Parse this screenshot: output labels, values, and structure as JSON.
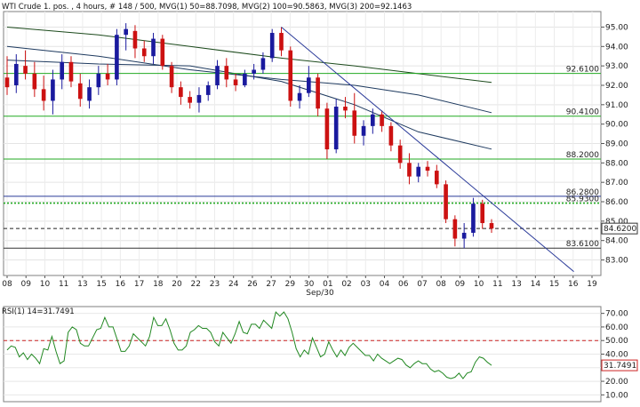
{
  "header": {
    "main_info": "WTI Crude 1. pos. , 4 hours, # 148 / 500, MVG(1) 50=88.7098, MVG(2) 100=90.5863, MVG(3) 200=92.1463",
    "rsi_info": "RSI(1) 14=31.7491"
  },
  "colors": {
    "up_candle": "#1a1a9e",
    "down_candle": "#cc1111",
    "mvg_dark": "#1e3a5f",
    "mvg_200": "#1c4a1c",
    "support_level": "#22aa22",
    "trendline": "#2a3a99",
    "rsi_line": "#228822",
    "rsi_ref": "#cc2222"
  },
  "chart_data": [
    {
      "type": "candlestick",
      "instrument": "WTI Crude 1. pos.",
      "timeframe": "4 hours",
      "ylim": [
        82.2,
        95.8
      ],
      "y_ticks": [
        83.0,
        84.0,
        85.0,
        86.0,
        87.0,
        88.0,
        89.0,
        90.0,
        91.0,
        92.0,
        93.0,
        94.0,
        95.0
      ],
      "x_tick_labels": [
        "08",
        "09",
        "10",
        "11",
        "13",
        "15",
        "16",
        "17",
        "18",
        "20",
        "22",
        "23",
        "24",
        "26",
        "27",
        "29",
        "30",
        "01",
        "02",
        "03",
        "04",
        "06",
        "07",
        "08",
        "09",
        "10",
        "11",
        "13",
        "14",
        "15",
        "16",
        "19"
      ],
      "x_axis_annotation": "Sep/30",
      "horizontal_levels": [
        {
          "label": "92.6100",
          "value": 92.61,
          "style": "green"
        },
        {
          "label": "90.4100",
          "value": 90.41,
          "style": "green"
        },
        {
          "label": "88.2000",
          "value": 88.2,
          "style": "green"
        },
        {
          "label": "86.2800",
          "value": 86.28,
          "style": "blue"
        },
        {
          "label": "85.9300",
          "value": 85.93,
          "style": "green-dotted"
        },
        {
          "label": "83.6100",
          "value": 83.61,
          "style": "dark"
        }
      ],
      "current_price": {
        "label": "84.6200",
        "value": 84.62
      },
      "candles": [
        {
          "o": 92.4,
          "h": 93.5,
          "l": 91.5,
          "c": 91.9
        },
        {
          "o": 92.0,
          "h": 93.6,
          "l": 91.6,
          "c": 93.1
        },
        {
          "o": 93.0,
          "h": 93.8,
          "l": 92.3,
          "c": 92.6
        },
        {
          "o": 92.6,
          "h": 93.2,
          "l": 91.4,
          "c": 91.8
        },
        {
          "o": 91.8,
          "h": 92.5,
          "l": 90.7,
          "c": 91.2
        },
        {
          "o": 91.2,
          "h": 92.8,
          "l": 90.5,
          "c": 92.3
        },
        {
          "o": 92.3,
          "h": 93.6,
          "l": 91.8,
          "c": 93.2
        },
        {
          "o": 93.2,
          "h": 93.5,
          "l": 91.9,
          "c": 92.2
        },
        {
          "o": 92.1,
          "h": 92.6,
          "l": 90.9,
          "c": 91.3
        },
        {
          "o": 91.2,
          "h": 92.3,
          "l": 90.8,
          "c": 91.9
        },
        {
          "o": 91.9,
          "h": 93.0,
          "l": 91.5,
          "c": 92.6
        },
        {
          "o": 92.6,
          "h": 93.1,
          "l": 92.0,
          "c": 92.3
        },
        {
          "o": 92.3,
          "h": 94.9,
          "l": 92.0,
          "c": 94.6
        },
        {
          "o": 94.6,
          "h": 95.2,
          "l": 93.8,
          "c": 94.9
        },
        {
          "o": 94.8,
          "h": 95.1,
          "l": 93.4,
          "c": 93.9
        },
        {
          "o": 93.9,
          "h": 94.3,
          "l": 93.2,
          "c": 93.5
        },
        {
          "o": 93.5,
          "h": 94.7,
          "l": 93.1,
          "c": 94.4
        },
        {
          "o": 94.4,
          "h": 94.6,
          "l": 92.8,
          "c": 93.0
        },
        {
          "o": 93.0,
          "h": 93.2,
          "l": 91.6,
          "c": 91.9
        },
        {
          "o": 91.9,
          "h": 92.2,
          "l": 91.0,
          "c": 91.4
        },
        {
          "o": 91.4,
          "h": 91.7,
          "l": 90.8,
          "c": 91.1
        },
        {
          "o": 91.1,
          "h": 91.9,
          "l": 90.6,
          "c": 91.5
        },
        {
          "o": 91.5,
          "h": 92.2,
          "l": 91.2,
          "c": 92.0
        },
        {
          "o": 92.0,
          "h": 93.3,
          "l": 91.8,
          "c": 93.0
        },
        {
          "o": 93.0,
          "h": 93.4,
          "l": 91.9,
          "c": 92.3
        },
        {
          "o": 92.3,
          "h": 92.6,
          "l": 91.7,
          "c": 92.0
        },
        {
          "o": 92.0,
          "h": 92.8,
          "l": 91.9,
          "c": 92.6
        },
        {
          "o": 92.6,
          "h": 93.1,
          "l": 92.3,
          "c": 92.8
        },
        {
          "o": 92.8,
          "h": 93.7,
          "l": 92.6,
          "c": 93.4
        },
        {
          "o": 93.4,
          "h": 94.9,
          "l": 93.2,
          "c": 94.7
        },
        {
          "o": 94.7,
          "h": 95.0,
          "l": 93.5,
          "c": 93.8
        },
        {
          "o": 93.8,
          "h": 94.0,
          "l": 90.9,
          "c": 91.2
        },
        {
          "o": 91.2,
          "h": 92.0,
          "l": 90.8,
          "c": 91.6
        },
        {
          "o": 91.6,
          "h": 93.0,
          "l": 91.4,
          "c": 92.4
        },
        {
          "o": 92.4,
          "h": 92.6,
          "l": 90.4,
          "c": 90.8
        },
        {
          "o": 90.8,
          "h": 91.1,
          "l": 88.2,
          "c": 88.7
        },
        {
          "o": 88.7,
          "h": 91.3,
          "l": 88.5,
          "c": 90.9
        },
        {
          "o": 90.9,
          "h": 91.4,
          "l": 90.3,
          "c": 90.7
        },
        {
          "o": 90.7,
          "h": 91.6,
          "l": 89.0,
          "c": 89.4
        },
        {
          "o": 89.4,
          "h": 90.2,
          "l": 88.9,
          "c": 89.9
        },
        {
          "o": 89.9,
          "h": 90.8,
          "l": 89.5,
          "c": 90.5
        },
        {
          "o": 90.5,
          "h": 90.7,
          "l": 89.6,
          "c": 89.9
        },
        {
          "o": 89.9,
          "h": 90.1,
          "l": 88.6,
          "c": 88.9
        },
        {
          "o": 88.9,
          "h": 89.2,
          "l": 87.7,
          "c": 88.0
        },
        {
          "o": 88.0,
          "h": 88.5,
          "l": 86.9,
          "c": 87.3
        },
        {
          "o": 87.3,
          "h": 88.0,
          "l": 87.0,
          "c": 87.8
        },
        {
          "o": 87.8,
          "h": 88.1,
          "l": 87.3,
          "c": 87.6
        },
        {
          "o": 87.6,
          "h": 87.9,
          "l": 86.7,
          "c": 86.9
        },
        {
          "o": 86.9,
          "h": 87.1,
          "l": 84.9,
          "c": 85.1
        },
        {
          "o": 85.1,
          "h": 85.3,
          "l": 83.7,
          "c": 84.1
        },
        {
          "o": 84.1,
          "h": 84.9,
          "l": 83.6,
          "c": 84.4
        },
        {
          "o": 84.4,
          "h": 86.2,
          "l": 84.2,
          "c": 85.9
        },
        {
          "o": 85.9,
          "h": 86.1,
          "l": 84.6,
          "c": 84.9
        },
        {
          "o": 84.9,
          "h": 85.1,
          "l": 84.4,
          "c": 84.62
        }
      ],
      "moving_averages": [
        {
          "name": "MVG(1) 50",
          "last": 88.7098,
          "points": [
            [
              0,
              93.3
            ],
            [
              10,
              93.1
            ],
            [
              20,
              93.0
            ],
            [
              30,
              92.2
            ],
            [
              38,
              91.0
            ],
            [
              45,
              89.6
            ],
            [
              53,
              88.71
            ]
          ]
        },
        {
          "name": "MVG(2) 100",
          "last": 90.5863,
          "points": [
            [
              0,
              94.0
            ],
            [
              10,
              93.5
            ],
            [
              20,
              92.8
            ],
            [
              30,
              92.3
            ],
            [
              38,
              92.0
            ],
            [
              45,
              91.5
            ],
            [
              53,
              90.59
            ]
          ]
        },
        {
          "name": "MVG(3) 200",
          "last": 92.1463,
          "points": [
            [
              0,
              95.0
            ],
            [
              10,
              94.6
            ],
            [
              20,
              94.0
            ],
            [
              30,
              93.4
            ],
            [
              38,
              93.0
            ],
            [
              45,
              92.6
            ],
            [
              53,
              92.15
            ]
          ]
        }
      ],
      "trendline": {
        "points": [
          [
            30,
            95.0
          ],
          [
            62,
            82.4
          ]
        ]
      }
    },
    {
      "type": "line",
      "name": "RSI(1) 14",
      "last": 31.7491,
      "ylim": [
        5,
        75
      ],
      "y_ticks": [
        10,
        20,
        30,
        40,
        50,
        60,
        70
      ],
      "reference_level": 50,
      "values": [
        43,
        46,
        45,
        38,
        41,
        36,
        40,
        37,
        33,
        44,
        43,
        53,
        42,
        33,
        35,
        56,
        60,
        58,
        48,
        46,
        46,
        52,
        58,
        59,
        67,
        60,
        60,
        51,
        42,
        42,
        46,
        55,
        52,
        49,
        46,
        53,
        67,
        61,
        61,
        66,
        58,
        48,
        43,
        43,
        46,
        56,
        58,
        61,
        59,
        59,
        56,
        49,
        46,
        56,
        52,
        48,
        55,
        64,
        56,
        55,
        62,
        62,
        59,
        65,
        62,
        59,
        71,
        68,
        71,
        66,
        56,
        44,
        38,
        43,
        40,
        52,
        45,
        38,
        40,
        49,
        43,
        38,
        43,
        39,
        45,
        48,
        45,
        42,
        39,
        39,
        35,
        40,
        37,
        35,
        33,
        35,
        37,
        36,
        32,
        30,
        33,
        35,
        33,
        33,
        29,
        27,
        28,
        26,
        23,
        22,
        23,
        26,
        22,
        26,
        27,
        34,
        38,
        37,
        34,
        31.75
      ]
    }
  ]
}
